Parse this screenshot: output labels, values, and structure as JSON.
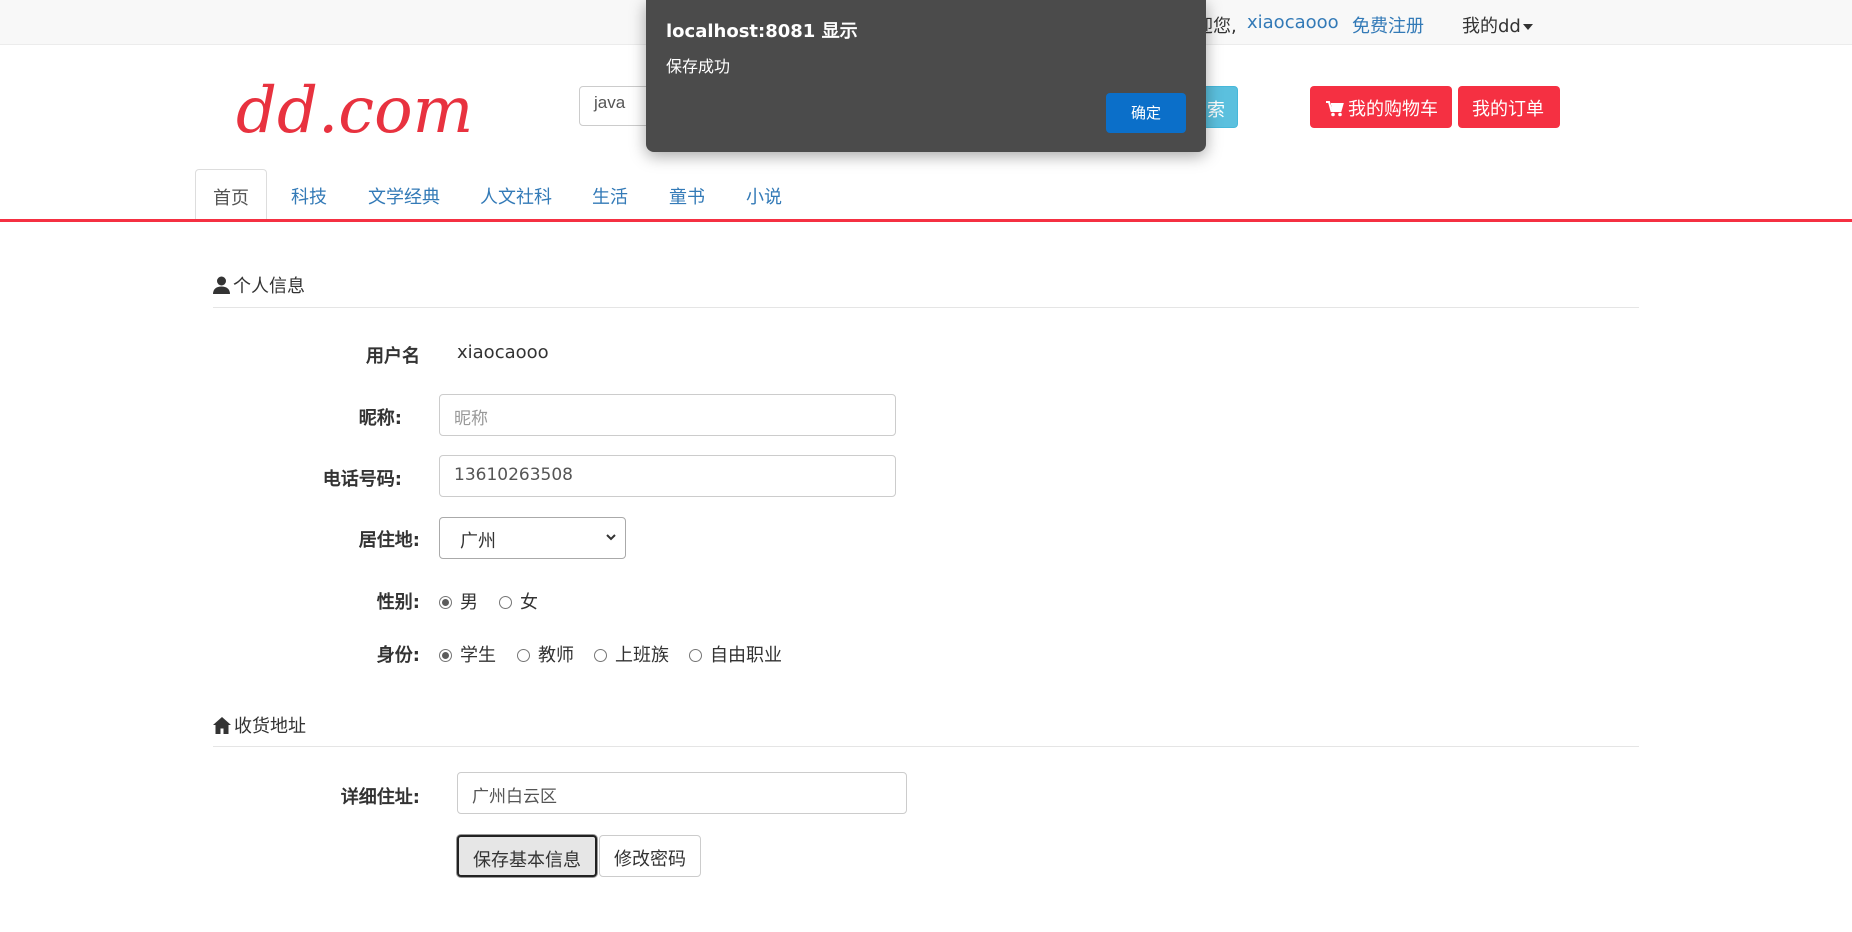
{
  "topbar": {
    "welcome": "迎您,",
    "username": "xiaocaooo",
    "register": "免费注册",
    "my_dd": "我的dd"
  },
  "header": {
    "logo": "dd.com",
    "search_value": "java",
    "search_button_visible": "索",
    "cart": "我的购物车",
    "orders": "我的订单"
  },
  "nav": {
    "tabs": [
      "首页",
      "科技",
      "文学经典",
      "人文社科",
      "生活",
      "童书",
      "小说"
    ],
    "active_index": 0
  },
  "profile": {
    "title": "个人信息",
    "username_label": "用户名",
    "username_value": "xiaocaooo",
    "nickname_label": "昵称:",
    "nickname_placeholder": "昵称",
    "phone_label": "电话号码:",
    "phone_value": "13610263508",
    "residence_label": "居住地:",
    "residence_value": "广州",
    "gender_label": "性别:",
    "gender_options": [
      "男",
      "女"
    ],
    "identity_label": "身份:",
    "identity_options": [
      "学生",
      "教师",
      "上班族",
      "自由职业"
    ]
  },
  "address": {
    "title": "收货地址",
    "detail_label": "详细住址:",
    "detail_value": "广州白云区",
    "save_button": "保存基本信息",
    "change_password_button": "修改密码"
  },
  "dialog": {
    "title": "localhost:8081 显示",
    "message": "保存成功",
    "ok": "确定"
  },
  "colors": {
    "accent_red": "#f53042",
    "link_blue": "#337ab7",
    "search_button": "#5bc0de",
    "dialog_bg": "#4b4b4b",
    "dialog_ok": "#0b6fc9"
  }
}
